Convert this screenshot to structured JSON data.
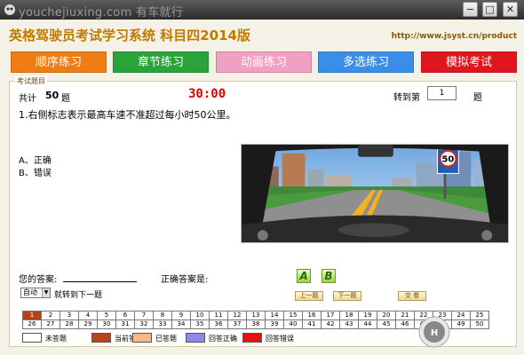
{
  "window": {
    "watermark": "youchejiuxing.com 有车就行",
    "minimize": "−",
    "maximize": "□",
    "close": "✕"
  },
  "header": {
    "title": "英格驾驶员考试学习系统 科目四2014版",
    "url": "http://www.jsyst.cn/product"
  },
  "nav": {
    "tabs": [
      {
        "label": "顺序练习",
        "color": "#f07d14"
      },
      {
        "label": "章节练习",
        "color": "#2aa33b"
      },
      {
        "label": "动画练习",
        "color": "#f0a0c0"
      },
      {
        "label": "多选练习",
        "color": "#3a8de8"
      },
      {
        "label": "模拟考试",
        "color": "#e0161e"
      }
    ]
  },
  "panel": {
    "legend": "考试题目",
    "total_label": "共计",
    "total_value": "50",
    "total_unit": "题",
    "timer": "30:00",
    "goto_label": "转到第",
    "goto_value": "1",
    "goto_unit": "题",
    "question": "1.右侧标志表示最高车速不准超过每小时50公里。",
    "options": [
      "A、正确",
      "B、错误"
    ],
    "sign_value": "50"
  },
  "answer": {
    "your_answer_label": "您的答案:",
    "correct_answer_label": "正确答案是:",
    "btn_a": "A",
    "btn_b": "B",
    "mode_select": "自动",
    "mode_text": "就转到下一题",
    "prev": "上一题",
    "next": "下一题",
    "submit": "交 卷"
  },
  "grid": {
    "row1": [
      "1",
      "2",
      "3",
      "4",
      "5",
      "6",
      "7",
      "8",
      "9",
      "10",
      "11",
      "12",
      "13",
      "14",
      "15",
      "16",
      "17",
      "18",
      "19",
      "20",
      "21",
      "22",
      "23",
      "24",
      "25"
    ],
    "row2": [
      "26",
      "27",
      "28",
      "29",
      "30",
      "31",
      "32",
      "33",
      "34",
      "35",
      "36",
      "37",
      "38",
      "39",
      "40",
      "41",
      "42",
      "43",
      "44",
      "45",
      "46",
      "47",
      "48",
      "49",
      "50"
    ],
    "current_index": 0
  },
  "legend": [
    {
      "label": "未答题",
      "color": "#ffffff"
    },
    {
      "label": "当前答题",
      "color": "#b5441c"
    },
    {
      "label": "已答题",
      "color": "#f5b98a"
    },
    {
      "label": "回答正确",
      "color": "#8a8ae8"
    },
    {
      "label": "回答错误",
      "color": "#e81010"
    }
  ]
}
